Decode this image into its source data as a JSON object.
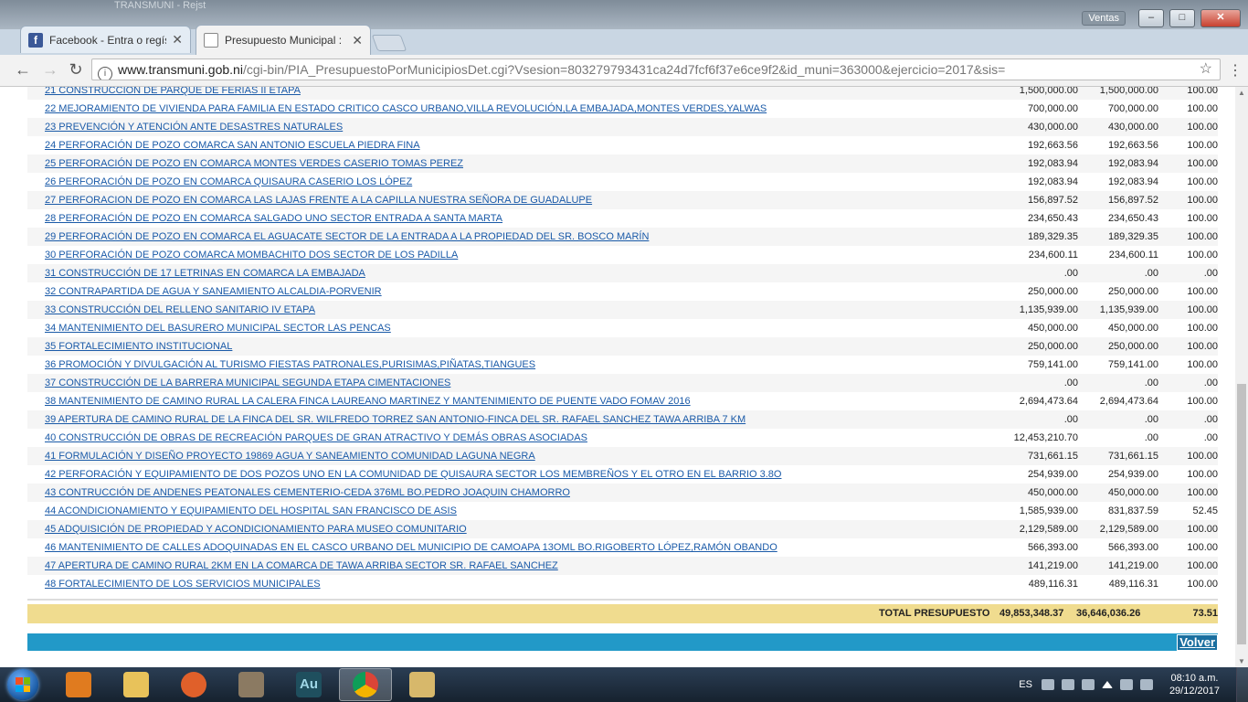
{
  "window": {
    "background_title": "TRANSMUNI - Rejst",
    "badge": "Ventas",
    "minimize": "–",
    "maximize": "□",
    "close": "✕"
  },
  "tabs": [
    {
      "label": "Facebook - Entra o regíst",
      "icon": "facebook-icon",
      "active": false
    },
    {
      "label": "Presupuesto Municipal :",
      "icon": "document-icon",
      "active": true
    }
  ],
  "tab_close": "✕",
  "nav": {
    "back": "←",
    "forward": "→",
    "reload": "↻",
    "star": "☆",
    "menu": "⋮"
  },
  "address": {
    "host": "www.transmuni.gob.ni",
    "path": "/cgi-bin/PIA_PresupuestoPorMunicipiosDet.cgi?Vsesion=803279793431ca24d7fcf6f37e6ce9f2&id_muni=363000&ejercicio=2017&sis="
  },
  "rows": [
    {
      "name": "21 CONSTRUCCION DE PARQUE DE FERIAS II ETAPA",
      "v1": "1,500,000.00",
      "v2": "1,500,000.00",
      "pct": "100.00"
    },
    {
      "name": "22 MEJORAMIENTO DE VIVIENDA PARA FAMILIA EN ESTADO CRITICO CASCO URBANO,VILLA REVOLUCIÓN,LA EMBAJADA,MONTES VERDES,YALWAS",
      "v1": "700,000.00",
      "v2": "700,000.00",
      "pct": "100.00"
    },
    {
      "name": "23 PREVENCIÓN Y ATENCIÓN ANTE DESASTRES NATURALES",
      "v1": "430,000.00",
      "v2": "430,000.00",
      "pct": "100.00"
    },
    {
      "name": "24 PERFORACIÓN DE POZO COMARCA SAN ANTONIO ESCUELA PIEDRA FINA",
      "v1": "192,663.56",
      "v2": "192,663.56",
      "pct": "100.00"
    },
    {
      "name": "25 PERFORACIÓN DE POZO EN COMARCA MONTES VERDES CASERIO TOMAS PEREZ",
      "v1": "192,083.94",
      "v2": "192,083.94",
      "pct": "100.00"
    },
    {
      "name": "26 PERFORACIÓN DE POZO EN COMARCA QUISAURA CASERIO LOS LÓPEZ",
      "v1": "192,083.94",
      "v2": "192,083.94",
      "pct": "100.00"
    },
    {
      "name": "27 PERFORACION DE POZO EN COMARCA LAS LAJAS FRENTE A LA CAPILLA NUESTRA SEÑORA DE GUADALUPE",
      "v1": "156,897.52",
      "v2": "156,897.52",
      "pct": "100.00"
    },
    {
      "name": "28 PERFORACIÓN DE POZO EN COMARCA SALGADO UNO SECTOR ENTRADA A SANTA MARTA",
      "v1": "234,650.43",
      "v2": "234,650.43",
      "pct": "100.00"
    },
    {
      "name": "29 PERFORACIÓN DE POZO EN COMARCA EL AGUACATE SECTOR DE LA ENTRADA A LA PROPIEDAD DEL SR. BOSCO MARÍN",
      "v1": "189,329.35",
      "v2": "189,329.35",
      "pct": "100.00"
    },
    {
      "name": "30 PERFORACIÓN DE POZO COMARCA MOMBACHITO DOS SECTOR DE LOS PADILLA",
      "v1": "234,600.11",
      "v2": "234,600.11",
      "pct": "100.00"
    },
    {
      "name": "31 CONSTRUCCIÓN DE 17 LETRINAS EN COMARCA LA EMBAJADA",
      "v1": ".00",
      "v2": ".00",
      "pct": ".00"
    },
    {
      "name": "32 CONTRAPARTIDA DE AGUA Y SANEAMIENTO ALCALDIA-PORVENIR",
      "v1": "250,000.00",
      "v2": "250,000.00",
      "pct": "100.00"
    },
    {
      "name": "33 CONSTRUCCIÓN DEL RELLENO SANITARIO IV ETAPA",
      "v1": "1,135,939.00",
      "v2": "1,135,939.00",
      "pct": "100.00"
    },
    {
      "name": "34 MANTENIMIENTO DEL BASURERO MUNICIPAL SECTOR LAS PENCAS",
      "v1": "450,000.00",
      "v2": "450,000.00",
      "pct": "100.00"
    },
    {
      "name": "35 FORTALECIMIENTO INSTITUCIONAL",
      "v1": "250,000.00",
      "v2": "250,000.00",
      "pct": "100.00"
    },
    {
      "name": "36 PROMOCIÓN Y DIVULGACIÓN AL TURISMO FIESTAS PATRONALES,PURISIMAS,PIÑATAS,TIANGUES",
      "v1": "759,141.00",
      "v2": "759,141.00",
      "pct": "100.00"
    },
    {
      "name": "37 CONSTRUCCIÓN DE LA BARRERA MUNICIPAL SEGUNDA ETAPA CIMENTACIONES",
      "v1": ".00",
      "v2": ".00",
      "pct": ".00"
    },
    {
      "name": "38 MANTENIMIENTO DE CAMINO RURAL LA CALERA FINCA LAUREANO MARTINEZ Y MANTENIMIENTO DE PUENTE VADO FOMAV 2016",
      "v1": "2,694,473.64",
      "v2": "2,694,473.64",
      "pct": "100.00"
    },
    {
      "name": "39 APERTURA DE CAMINO RURAL DE LA FINCA DEL SR. WILFREDO TORREZ SAN ANTONIO-FINCA DEL SR. RAFAEL SANCHEZ TAWA ARRIBA 7 KM",
      "v1": ".00",
      "v2": ".00",
      "pct": ".00"
    },
    {
      "name": "40 CONSTRUCCIÓN DE OBRAS DE RECREACIÓN PARQUES DE GRAN ATRACTIVO Y DEMÁS OBRAS ASOCIADAS",
      "v1": "12,453,210.70",
      "v2": ".00",
      "pct": ".00"
    },
    {
      "name": "41 FORMULACIÓN Y DISEÑO PROYECTO 19869 AGUA Y SANEAMIENTO COMUNIDAD LAGUNA NEGRA",
      "v1": "731,661.15",
      "v2": "731,661.15",
      "pct": "100.00"
    },
    {
      "name": "42 PERFORACIÓN Y EQUIPAMIENTO DE DOS POZOS UNO EN LA COMUNIDAD DE QUISAURA SECTOR LOS MEMBREÑOS Y EL OTRO EN EL BARRIO 3.8O",
      "v1": "254,939.00",
      "v2": "254,939.00",
      "pct": "100.00"
    },
    {
      "name": "43 CONTRUCCIÓN DE ANDENES PEATONALES CEMENTERIO-CEDA 376ML BO.PEDRO JOAQUIN CHAMORRO",
      "v1": "450,000.00",
      "v2": "450,000.00",
      "pct": "100.00"
    },
    {
      "name": "44 ACONDICIONAMIENTO Y EQUIPAMIENTO DEL HOSPITAL SAN FRANCISCO DE ASIS",
      "v1": "1,585,939.00",
      "v2": "831,837.59",
      "pct": "52.45"
    },
    {
      "name": "45 ADQUISICIÓN DE PROPIEDAD Y ACONDICIONAMIENTO PARA MUSEO COMUNITARIO",
      "v1": "2,129,589.00",
      "v2": "2,129,589.00",
      "pct": "100.00"
    },
    {
      "name": "46 MANTENIMIENTO DE CALLES ADOQUINADAS EN EL CASCO URBANO DEL MUNICIPIO DE CAMOAPA 13OML BO.RIGOBERTO LÓPEZ,RAMÓN OBANDO",
      "v1": "566,393.00",
      "v2": "566,393.00",
      "pct": "100.00"
    },
    {
      "name": "47 APERTURA DE CAMINO RURAL 2KM EN LA COMARCA DE TAWA ARRIBA SECTOR SR. RAFAEL SANCHEZ",
      "v1": "141,219.00",
      "v2": "141,219.00",
      "pct": "100.00"
    },
    {
      "name": "48 FORTALECIMIENTO DE LOS SERVICIOS MUNICIPALES",
      "v1": "489,116.31",
      "v2": "489,116.31",
      "pct": "100.00"
    }
  ],
  "total": {
    "label": "TOTAL PRESUPUESTO",
    "v1": "49,853,348.37",
    "v2": "36,646,036.26",
    "pct": "73.51"
  },
  "volver": "Volver",
  "taskbar": {
    "apps": [
      {
        "name": "media-player-icon",
        "color": "#e07b1f"
      },
      {
        "name": "file-explorer-icon",
        "color": "#e8c25a"
      },
      {
        "name": "firefox-icon",
        "color": "#e0602a"
      },
      {
        "name": "gimp-icon",
        "color": "#8b7a62"
      },
      {
        "name": "audition-icon",
        "color": "#1f4f5e",
        "text": "Au"
      },
      {
        "name": "chrome-icon",
        "color": "#4caf50",
        "active": true
      },
      {
        "name": "paint-icon",
        "color": "#d7b86b"
      }
    ],
    "lang": "ES",
    "time": "08:10 a.m.",
    "date": "29/12/2017"
  }
}
